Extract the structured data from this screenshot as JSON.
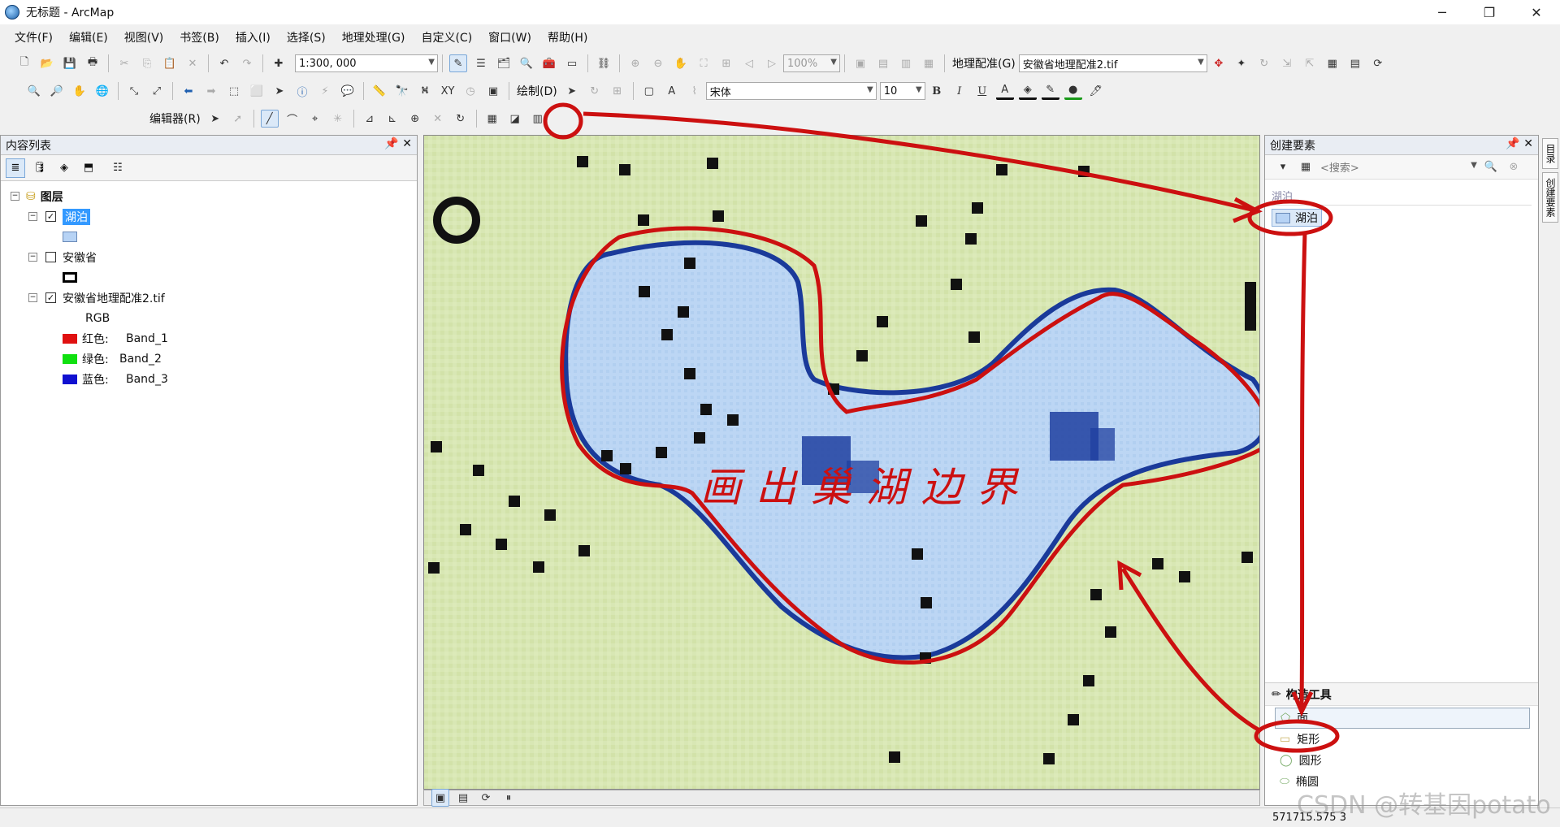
{
  "window": {
    "title": "无标题 - ArcMap",
    "minimize": "─",
    "restore": "❐",
    "close": "✕"
  },
  "menu": [
    "文件(F)",
    "编辑(E)",
    "视图(V)",
    "书签(B)",
    "插入(I)",
    "选择(S)",
    "地理处理(G)",
    "自定义(C)",
    "窗口(W)",
    "帮助(H)"
  ],
  "toolbar": {
    "scale": "1:300, 000",
    "zoom_percent": "100%",
    "georef_label": "地理配准(G)",
    "georef_layer": "安徽省地理配准2.tif",
    "draw_label": "绘制(D)",
    "font_name": "宋体",
    "font_size": "10",
    "bold": "B",
    "italic": "I",
    "underline": "U",
    "editor_label": "编辑器(R)"
  },
  "toc": {
    "title": "内容列表",
    "pin": "ᵖ",
    "close": "✕",
    "layers_root": "图层",
    "layers": [
      {
        "name": "湖泊",
        "checked": true,
        "selected": true
      },
      {
        "name": "安徽省",
        "checked": false
      },
      {
        "name": "安徽省地理配准2.tif",
        "checked": true,
        "rgb": "RGB"
      }
    ],
    "bands": [
      {
        "color_name": "红色:",
        "band": "Band_1",
        "color": "#e01010"
      },
      {
        "color_name": "绿色:",
        "band": "Band_2",
        "color": "#10e010"
      },
      {
        "color_name": "蓝色:",
        "band": "Band_3",
        "color": "#1010d0"
      }
    ]
  },
  "map": {
    "annotation_text": "画出巢湖边界",
    "annotation_color": "#cc1010",
    "lake_fill": "#b9d5f3",
    "land_fill": "#d6e6b0"
  },
  "create_features": {
    "title": "创建要素",
    "search_placeholder": "<搜索>",
    "group": "湖泊",
    "template": "湖泊",
    "construction_tools_title": "构造工具",
    "tools": [
      "面",
      "矩形",
      "圆形",
      "椭圆"
    ]
  },
  "side_tabs": [
    "目录",
    "创建要素"
  ],
  "status": {
    "coords": "571715.575  3"
  },
  "watermark": "CSDN @转基因potato"
}
